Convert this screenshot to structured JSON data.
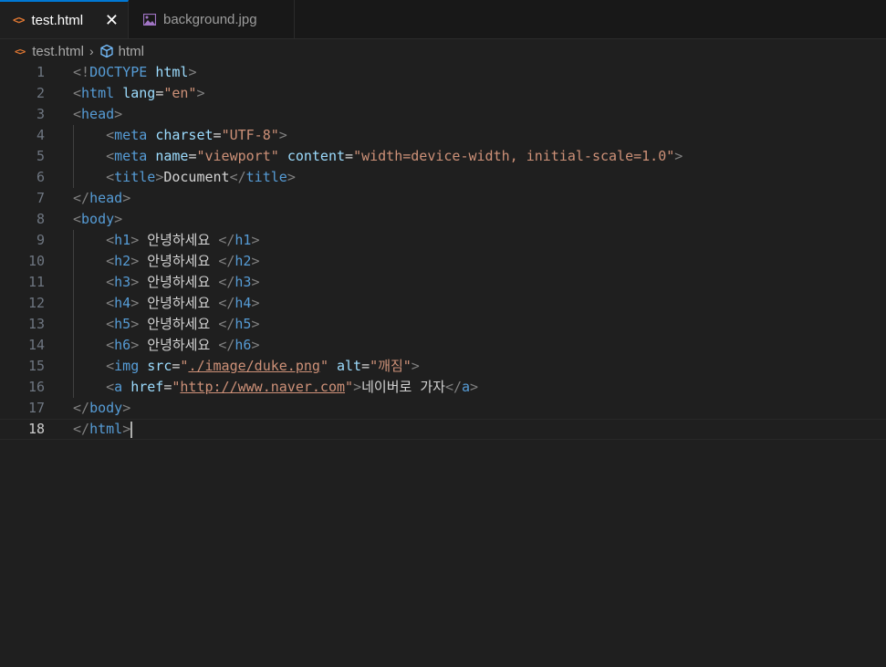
{
  "tabs": [
    {
      "label": "test.html",
      "icon": "html-file-icon",
      "active": true
    },
    {
      "label": "background.jpg",
      "icon": "image-file-icon",
      "active": false
    }
  ],
  "breadcrumb": {
    "file": "test.html",
    "symbol": "html"
  },
  "lines": [
    {
      "n": "1",
      "toks": [
        [
          "br",
          "<!"
        ],
        [
          "tag",
          "DOCTYPE"
        ],
        [
          "txt",
          " "
        ],
        [
          "attr",
          "html"
        ],
        [
          "br",
          ">"
        ]
      ]
    },
    {
      "n": "2",
      "toks": [
        [
          "br",
          "<"
        ],
        [
          "tag",
          "html"
        ],
        [
          "txt",
          " "
        ],
        [
          "attr",
          "lang"
        ],
        [
          "txt",
          "="
        ],
        [
          "str",
          "\"en\""
        ],
        [
          "br",
          ">"
        ]
      ]
    },
    {
      "n": "3",
      "toks": [
        [
          "br",
          "<"
        ],
        [
          "tag",
          "head"
        ],
        [
          "br",
          ">"
        ]
      ]
    },
    {
      "n": "4",
      "toks": [
        [
          "txt",
          "    "
        ],
        [
          "br",
          "<"
        ],
        [
          "tag",
          "meta"
        ],
        [
          "txt",
          " "
        ],
        [
          "attr",
          "charset"
        ],
        [
          "txt",
          "="
        ],
        [
          "str",
          "\"UTF-8\""
        ],
        [
          "br",
          ">"
        ]
      ]
    },
    {
      "n": "5",
      "toks": [
        [
          "txt",
          "    "
        ],
        [
          "br",
          "<"
        ],
        [
          "tag",
          "meta"
        ],
        [
          "txt",
          " "
        ],
        [
          "attr",
          "name"
        ],
        [
          "txt",
          "="
        ],
        [
          "str",
          "\"viewport\""
        ],
        [
          "txt",
          " "
        ],
        [
          "attr",
          "content"
        ],
        [
          "txt",
          "="
        ],
        [
          "str",
          "\"width=device-width, initial-scale=1.0\""
        ],
        [
          "br",
          ">"
        ]
      ]
    },
    {
      "n": "6",
      "toks": [
        [
          "txt",
          "    "
        ],
        [
          "br",
          "<"
        ],
        [
          "tag",
          "title"
        ],
        [
          "br",
          ">"
        ],
        [
          "txt",
          "Document"
        ],
        [
          "br",
          "</"
        ],
        [
          "tag",
          "title"
        ],
        [
          "br",
          ">"
        ]
      ]
    },
    {
      "n": "7",
      "toks": [
        [
          "br",
          "</"
        ],
        [
          "tag",
          "head"
        ],
        [
          "br",
          ">"
        ]
      ]
    },
    {
      "n": "8",
      "toks": [
        [
          "br",
          "<"
        ],
        [
          "tag",
          "body"
        ],
        [
          "br",
          ">"
        ]
      ]
    },
    {
      "n": "9",
      "toks": [
        [
          "txt",
          "    "
        ],
        [
          "br",
          "<"
        ],
        [
          "tag",
          "h1"
        ],
        [
          "br",
          ">"
        ],
        [
          "txt",
          " 안녕하세요 "
        ],
        [
          "br",
          "</"
        ],
        [
          "tag",
          "h1"
        ],
        [
          "br",
          ">"
        ]
      ]
    },
    {
      "n": "10",
      "toks": [
        [
          "txt",
          "    "
        ],
        [
          "br",
          "<"
        ],
        [
          "tag",
          "h2"
        ],
        [
          "br",
          ">"
        ],
        [
          "txt",
          " 안녕하세요 "
        ],
        [
          "br",
          "</"
        ],
        [
          "tag",
          "h2"
        ],
        [
          "br",
          ">"
        ]
      ]
    },
    {
      "n": "11",
      "toks": [
        [
          "txt",
          "    "
        ],
        [
          "br",
          "<"
        ],
        [
          "tag",
          "h3"
        ],
        [
          "br",
          ">"
        ],
        [
          "txt",
          " 안녕하세요 "
        ],
        [
          "br",
          "</"
        ],
        [
          "tag",
          "h3"
        ],
        [
          "br",
          ">"
        ]
      ]
    },
    {
      "n": "12",
      "toks": [
        [
          "txt",
          "    "
        ],
        [
          "br",
          "<"
        ],
        [
          "tag",
          "h4"
        ],
        [
          "br",
          ">"
        ],
        [
          "txt",
          " 안녕하세요 "
        ],
        [
          "br",
          "</"
        ],
        [
          "tag",
          "h4"
        ],
        [
          "br",
          ">"
        ]
      ]
    },
    {
      "n": "13",
      "toks": [
        [
          "txt",
          "    "
        ],
        [
          "br",
          "<"
        ],
        [
          "tag",
          "h5"
        ],
        [
          "br",
          ">"
        ],
        [
          "txt",
          " 안녕하세요 "
        ],
        [
          "br",
          "</"
        ],
        [
          "tag",
          "h5"
        ],
        [
          "br",
          ">"
        ]
      ]
    },
    {
      "n": "14",
      "toks": [
        [
          "txt",
          "    "
        ],
        [
          "br",
          "<"
        ],
        [
          "tag",
          "h6"
        ],
        [
          "br",
          ">"
        ],
        [
          "txt",
          " 안녕하세요 "
        ],
        [
          "br",
          "</"
        ],
        [
          "tag",
          "h6"
        ],
        [
          "br",
          ">"
        ]
      ]
    },
    {
      "n": "15",
      "toks": [
        [
          "txt",
          "    "
        ],
        [
          "br",
          "<"
        ],
        [
          "tag",
          "img"
        ],
        [
          "txt",
          " "
        ],
        [
          "attr",
          "src"
        ],
        [
          "txt",
          "="
        ],
        [
          "str",
          "\""
        ],
        [
          "link",
          "./image/duke.png"
        ],
        [
          "str",
          "\""
        ],
        [
          "txt",
          " "
        ],
        [
          "attr",
          "alt"
        ],
        [
          "txt",
          "="
        ],
        [
          "str",
          "\"깨짐\""
        ],
        [
          "br",
          ">"
        ]
      ]
    },
    {
      "n": "16",
      "toks": [
        [
          "txt",
          "    "
        ],
        [
          "br",
          "<"
        ],
        [
          "tag",
          "a"
        ],
        [
          "txt",
          " "
        ],
        [
          "attr",
          "href"
        ],
        [
          "txt",
          "="
        ],
        [
          "str",
          "\""
        ],
        [
          "link",
          "http://www.naver.com"
        ],
        [
          "str",
          "\""
        ],
        [
          "br",
          ">"
        ],
        [
          "txt",
          "네이버로 가자"
        ],
        [
          "br",
          "</"
        ],
        [
          "tag",
          "a"
        ],
        [
          "br",
          ">"
        ]
      ]
    },
    {
      "n": "17",
      "toks": [
        [
          "br",
          "</"
        ],
        [
          "tag",
          "body"
        ],
        [
          "br",
          ">"
        ]
      ]
    },
    {
      "n": "18",
      "toks": [
        [
          "br",
          "</"
        ],
        [
          "tag",
          "html"
        ],
        [
          "br",
          ">"
        ]
      ],
      "current": true
    }
  ]
}
